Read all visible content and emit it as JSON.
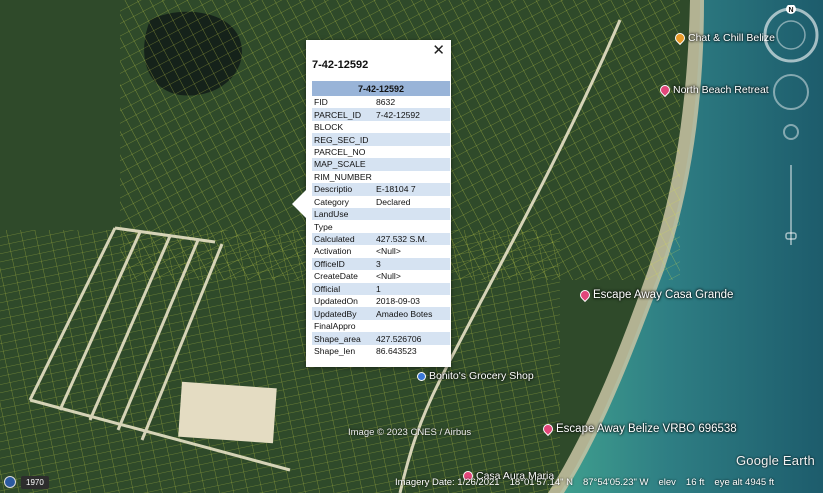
{
  "popup": {
    "title": "7-42-12592",
    "header": "7-42-12592",
    "close_symbol": "✕",
    "rows": [
      {
        "key": "FID",
        "value": "8632"
      },
      {
        "key": "PARCEL_ID",
        "value": "7-42-12592"
      },
      {
        "key": "BLOCK",
        "value": ""
      },
      {
        "key": "REG_SEC_ID",
        "value": ""
      },
      {
        "key": "PARCEL_NO",
        "value": ""
      },
      {
        "key": "MAP_SCALE",
        "value": ""
      },
      {
        "key": "RIM_NUMBER",
        "value": ""
      },
      {
        "key": "Descriptio",
        "value": "E-18104 7"
      },
      {
        "key": "Category",
        "value": "Declared"
      },
      {
        "key": "LandUse",
        "value": ""
      },
      {
        "key": "Type",
        "value": ""
      },
      {
        "key": "Calculated",
        "value": "427.532 S.M."
      },
      {
        "key": "Activation",
        "value": "<Null>"
      },
      {
        "key": "OfficeID",
        "value": "3"
      },
      {
        "key": "CreateDate",
        "value": "<Null>"
      },
      {
        "key": "Official",
        "value": "1"
      },
      {
        "key": "UpdatedOn",
        "value": "2018-09-03"
      },
      {
        "key": "UpdatedBy",
        "value": "Amadeo Botes"
      },
      {
        "key": "FinalAppro",
        "value": ""
      },
      {
        "key": "Shape_area",
        "value": "427.526706"
      },
      {
        "key": "Shape_len",
        "value": "86.643523"
      }
    ]
  },
  "places": {
    "chat_chill": "Chat & Chill Belize",
    "north_beach": "North Beach Retreat",
    "escape_grande": "Escape Away Casa Grande",
    "bonitos": "Bonito's Grocery Shop",
    "escape_vrbo": "Escape Away Belize VRBO 696538",
    "casa_aura": "Casa Aura Maria"
  },
  "credits": {
    "image": "Image © 2023 CNES / Airbus",
    "logo": "Google Earth"
  },
  "status": {
    "imagery_date": "Imagery Date: 1/26/2021",
    "lat": "18°01'57.14\" N",
    "lon": "87°54'05.23\" W",
    "elev_label": "elev",
    "elev_value": "16 ft",
    "eye_alt": "eye alt  4945 ft",
    "year": "1970"
  },
  "nav": {
    "north_label": "N"
  },
  "colors": {
    "sea": "#2d8a86",
    "parcel_lines": "#d9e24a",
    "popup_header": "#99b4d8",
    "row_alt": "#d6e3f2"
  }
}
